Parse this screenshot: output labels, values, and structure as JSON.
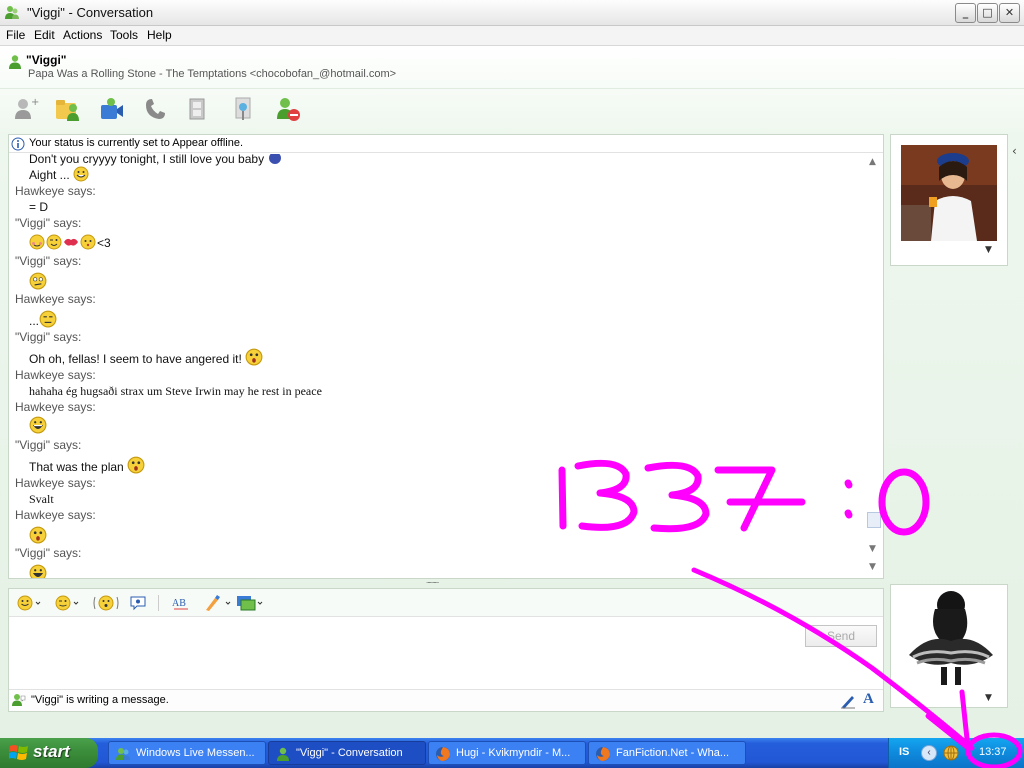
{
  "window": {
    "title": "\"Viggi\" - Conversation",
    "controls": {
      "minimize": "_",
      "maximize": "□",
      "close": "✕"
    }
  },
  "menu": [
    "File",
    "Edit",
    "Actions",
    "Tools",
    "Help"
  ],
  "contact": {
    "name": "\"Viggi\"",
    "personal_message": "Papa Was a Rolling Stone - The Temptations <chocobofan_@hotmail.com>"
  },
  "toolbar_icons": [
    "invite-contact-icon",
    "share-files-icon",
    "video-call-icon",
    "call-icon",
    "webcam-icon",
    "activities-icon",
    "block-contact-icon"
  ],
  "status_notice": "Your status is currently set to Appear offline.",
  "conversation": [
    {
      "type": "msg",
      "text": "Don't you cryyyy tonight, I still love you baby"
    },
    {
      "type": "msg",
      "text": "Aight ..."
    },
    {
      "type": "speaker",
      "text": "Hawkeye says:"
    },
    {
      "type": "msg",
      "text": "= D"
    },
    {
      "type": "speaker",
      "text": "\"Viggi\" says:"
    },
    {
      "type": "msg",
      "text": "<3"
    },
    {
      "type": "speaker",
      "text": "\"Viggi\" says:"
    },
    {
      "type": "speaker",
      "text": "Hawkeye says:"
    },
    {
      "type": "msg",
      "text": "..."
    },
    {
      "type": "speaker",
      "text": "\"Viggi\" says:"
    },
    {
      "type": "msg",
      "text": "Oh oh, fellas! I seem to have angered it!"
    },
    {
      "type": "speaker",
      "text": "Hawkeye says:"
    },
    {
      "type": "msg",
      "text": "hahaha ég hugsaði strax um Steve Irwin may he rest in peace"
    },
    {
      "type": "speaker",
      "text": "Hawkeye says:"
    },
    {
      "type": "speaker",
      "text": "\"Viggi\" says:"
    },
    {
      "type": "msg",
      "text": "That was the plan"
    },
    {
      "type": "speaker",
      "text": "Hawkeye says:"
    },
    {
      "type": "msg",
      "text": "Svalt"
    },
    {
      "type": "speaker",
      "text": "Hawkeye says:"
    },
    {
      "type": "speaker",
      "text": "\"Viggi\" says:"
    }
  ],
  "splitter": "..........",
  "input": {
    "send_label": "Send",
    "typing_status": "\"Viggi\" is writing a message."
  },
  "input_toolbar_icons": [
    "emoticon-icon",
    "wink-icon",
    "nudge-icon",
    "voice-clip-icon",
    "spellcheck-icon",
    "ink-icon",
    "background-icon"
  ],
  "annotation": {
    "text": "1337 :0",
    "color": "#ff00ff"
  },
  "taskbar": {
    "start_label": "start",
    "tasks": [
      {
        "label": "Windows Live Messen...",
        "active": false
      },
      {
        "label": "\"Viggi\" - Conversation",
        "active": true
      },
      {
        "label": "Hugi - Kvikmyndir - M...",
        "active": false
      },
      {
        "label": "FanFiction.Net - Wha...",
        "active": false
      }
    ],
    "language": "IS",
    "clock": "13:37"
  },
  "colors": {
    "taskbar": "#245edb",
    "start": "#3c8f3c",
    "window_bg": "#e5f1e5",
    "annotation": "#ff00ff"
  }
}
